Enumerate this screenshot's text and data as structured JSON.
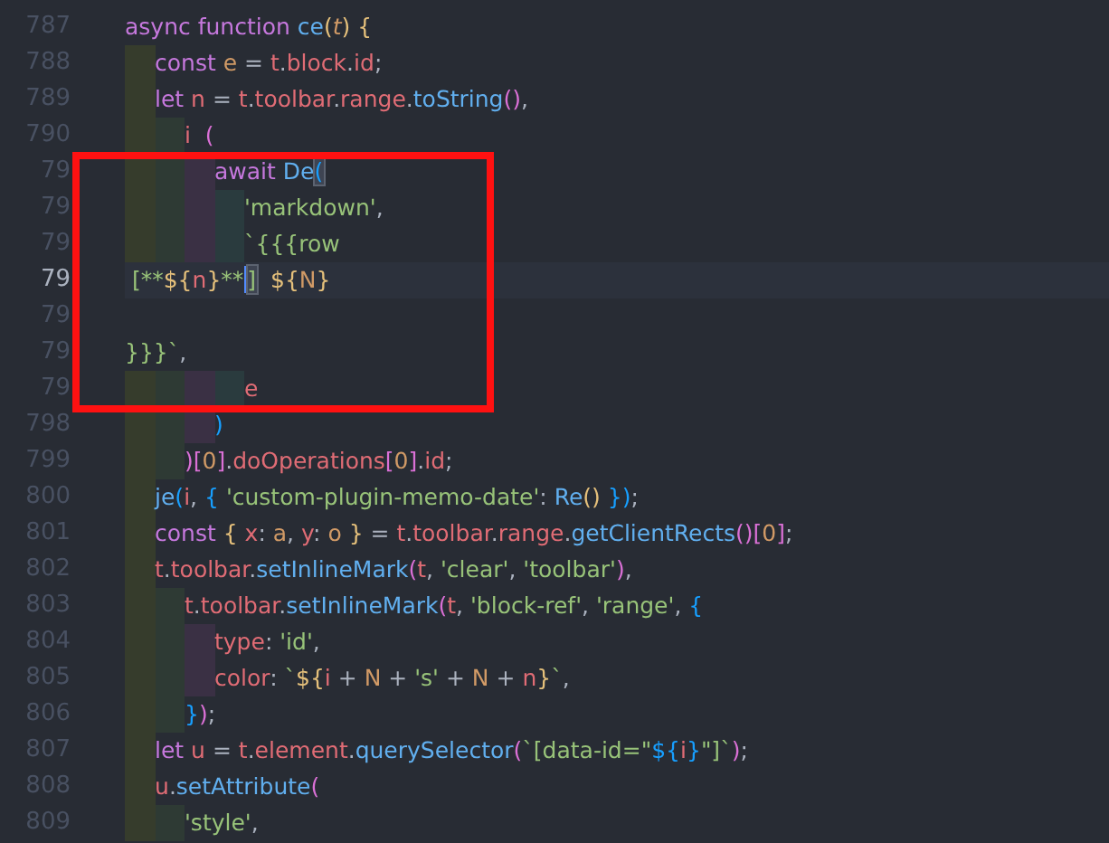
{
  "editor": {
    "lines": [
      {
        "number": "787",
        "current": false,
        "tokens": [
          {
            "text": "async ",
            "kind": "keyword"
          },
          {
            "text": "function ",
            "kind": "keyword"
          },
          {
            "text": "ce",
            "kind": "function"
          },
          {
            "text": "(",
            "kind": "bracket"
          },
          {
            "text": "t",
            "kind": "parameter"
          },
          {
            "text": ")",
            "kind": "bracket"
          },
          {
            "text": " {",
            "kind": "bracket"
          }
        ]
      },
      {
        "number": "788",
        "current": false,
        "tokens": [
          {
            "text": "    const ",
            "kind": "keyword"
          },
          {
            "text": "e",
            "kind": "number"
          },
          {
            "text": " = ",
            "kind": "operator"
          },
          {
            "text": "t",
            "kind": "variable"
          },
          {
            "text": ".",
            "kind": "operator"
          },
          {
            "text": "block",
            "kind": "variable"
          },
          {
            "text": ".",
            "kind": "operator"
          },
          {
            "text": "id",
            "kind": "variable"
          },
          {
            "text": ";",
            "kind": "operator"
          }
        ]
      },
      {
        "number": "789",
        "current": false,
        "tokens": [
          {
            "text": "    let ",
            "kind": "keyword"
          },
          {
            "text": "n",
            "kind": "variable"
          },
          {
            "text": " = ",
            "kind": "operator"
          },
          {
            "text": "t",
            "kind": "variable"
          },
          {
            "text": ".",
            "kind": "operator"
          },
          {
            "text": "toolbar",
            "kind": "variable"
          },
          {
            "text": ".",
            "kind": "operator"
          },
          {
            "text": "range",
            "kind": "variable"
          },
          {
            "text": ".",
            "kind": "operator"
          },
          {
            "text": "toString",
            "kind": "function"
          },
          {
            "text": "()",
            "kind": "paren"
          },
          {
            "text": ",",
            "kind": "operator"
          }
        ]
      },
      {
        "number": "790",
        "current": false,
        "tokens": [
          {
            "text": "        i",
            "kind": "variable"
          },
          {
            "text": "  (",
            "kind": "paren"
          }
        ]
      },
      {
        "number": "79",
        "current": false,
        "tokens": [
          {
            "text": "            await ",
            "kind": "keyword"
          },
          {
            "text": "De",
            "kind": "function"
          },
          {
            "text": "(",
            "kind": "brace",
            "matched": true,
            "cursor": false
          }
        ]
      },
      {
        "number": "79",
        "current": false,
        "tokens": [
          {
            "text": "                'markdown'",
            "kind": "string"
          },
          {
            "text": ",",
            "kind": "operator"
          }
        ]
      },
      {
        "number": "79",
        "current": false,
        "tokens": [
          {
            "text": "                `{{{row",
            "kind": "string"
          }
        ]
      },
      {
        "number": "79",
        "current": true,
        "tokens": [
          {
            "text": " [**",
            "kind": "string"
          },
          {
            "text": "${",
            "kind": "bracket"
          },
          {
            "text": "n",
            "kind": "variable"
          },
          {
            "text": "}",
            "kind": "bracket"
          },
          {
            "text": "**",
            "kind": "string",
            "matched": false,
            "cursor": true
          },
          {
            "text": "]",
            "kind": "string",
            "matched": true,
            "cursor": false
          },
          {
            "text": "  ${",
            "kind": "bracket"
          },
          {
            "text": "N",
            "kind": "number"
          },
          {
            "text": "}",
            "kind": "bracket"
          }
        ]
      },
      {
        "number": "79",
        "current": false
      },
      {
        "number": "79",
        "current": false,
        "tokens": [
          {
            "text": "}}}`",
            "kind": "string"
          },
          {
            "text": ",",
            "kind": "operator"
          }
        ]
      },
      {
        "number": "79",
        "current": false,
        "tokens": [
          {
            "text": "                e",
            "kind": "variable"
          }
        ]
      },
      {
        "number": "798",
        "current": false,
        "tokens": [
          {
            "text": "            )",
            "kind": "brace"
          }
        ]
      },
      {
        "number": "799",
        "current": false,
        "tokens": [
          {
            "text": "        )[",
            "kind": "paren"
          },
          {
            "text": "0",
            "kind": "number"
          },
          {
            "text": "]",
            "kind": "paren"
          },
          {
            "text": ".",
            "kind": "operator"
          },
          {
            "text": "doOperations",
            "kind": "variable"
          },
          {
            "text": "[",
            "kind": "paren"
          },
          {
            "text": "0",
            "kind": "number"
          },
          {
            "text": "]",
            "kind": "paren"
          },
          {
            "text": ".",
            "kind": "operator"
          },
          {
            "text": "id",
            "kind": "variable"
          },
          {
            "text": ";",
            "kind": "operator"
          }
        ]
      },
      {
        "number": "800",
        "current": false,
        "tokens": [
          {
            "text": "    je",
            "kind": "function"
          },
          {
            "text": "(",
            "kind": "brace"
          },
          {
            "text": "i",
            "kind": "variable"
          },
          {
            "text": ", ",
            "kind": "operator"
          },
          {
            "text": "{ ",
            "kind": "brace"
          },
          {
            "text": "'custom-plugin-memo-date'",
            "kind": "string"
          },
          {
            "text": ": ",
            "kind": "operator"
          },
          {
            "text": "Re",
            "kind": "function"
          },
          {
            "text": "()",
            "kind": "bracket"
          },
          {
            "text": " })",
            "kind": "brace"
          },
          {
            "text": ";",
            "kind": "operator"
          }
        ]
      },
      {
        "number": "801",
        "current": false,
        "tokens": [
          {
            "text": "    const ",
            "kind": "keyword"
          },
          {
            "text": "{ ",
            "kind": "bracket"
          },
          {
            "text": "x",
            "kind": "variable"
          },
          {
            "text": ": ",
            "kind": "operator"
          },
          {
            "text": "a",
            "kind": "number"
          },
          {
            "text": ", ",
            "kind": "operator"
          },
          {
            "text": "y",
            "kind": "variable"
          },
          {
            "text": ": ",
            "kind": "operator"
          },
          {
            "text": "o",
            "kind": "number"
          },
          {
            "text": " }",
            "kind": "bracket"
          },
          {
            "text": " = ",
            "kind": "operator"
          },
          {
            "text": "t",
            "kind": "variable"
          },
          {
            "text": ".",
            "kind": "operator"
          },
          {
            "text": "toolbar",
            "kind": "variable"
          },
          {
            "text": ".",
            "kind": "operator"
          },
          {
            "text": "range",
            "kind": "variable"
          },
          {
            "text": ".",
            "kind": "operator"
          },
          {
            "text": "getClientRects",
            "kind": "function"
          },
          {
            "text": "()[",
            "kind": "paren"
          },
          {
            "text": "0",
            "kind": "number"
          },
          {
            "text": "]",
            "kind": "paren"
          },
          {
            "text": ";",
            "kind": "operator"
          }
        ]
      },
      {
        "number": "802",
        "current": false,
        "tokens": [
          {
            "text": "    t",
            "kind": "variable"
          },
          {
            "text": ".",
            "kind": "operator"
          },
          {
            "text": "toolbar",
            "kind": "variable"
          },
          {
            "text": ".",
            "kind": "operator"
          },
          {
            "text": "setInlineMark",
            "kind": "function"
          },
          {
            "text": "(",
            "kind": "paren"
          },
          {
            "text": "t",
            "kind": "variable"
          },
          {
            "text": ", ",
            "kind": "operator"
          },
          {
            "text": "'clear'",
            "kind": "string"
          },
          {
            "text": ", ",
            "kind": "operator"
          },
          {
            "text": "'toolbar'",
            "kind": "string"
          },
          {
            "text": ")",
            "kind": "paren"
          },
          {
            "text": ",",
            "kind": "operator"
          }
        ]
      },
      {
        "number": "803",
        "current": false,
        "tokens": [
          {
            "text": "        t",
            "kind": "variable"
          },
          {
            "text": ".",
            "kind": "operator"
          },
          {
            "text": "toolbar",
            "kind": "variable"
          },
          {
            "text": ".",
            "kind": "operator"
          },
          {
            "text": "setInlineMark",
            "kind": "function"
          },
          {
            "text": "(",
            "kind": "paren"
          },
          {
            "text": "t",
            "kind": "variable"
          },
          {
            "text": ", ",
            "kind": "operator"
          },
          {
            "text": "'block-ref'",
            "kind": "string"
          },
          {
            "text": ", ",
            "kind": "operator"
          },
          {
            "text": "'range'",
            "kind": "string"
          },
          {
            "text": ", ",
            "kind": "operator"
          },
          {
            "text": "{",
            "kind": "brace"
          }
        ]
      },
      {
        "number": "804",
        "current": false,
        "tokens": [
          {
            "text": "            type",
            "kind": "variable"
          },
          {
            "text": ": ",
            "kind": "operator"
          },
          {
            "text": "'id'",
            "kind": "string"
          },
          {
            "text": ",",
            "kind": "operator"
          }
        ]
      },
      {
        "number": "805",
        "current": false,
        "tokens": [
          {
            "text": "            color",
            "kind": "variable"
          },
          {
            "text": ": ",
            "kind": "operator"
          },
          {
            "text": "`",
            "kind": "string"
          },
          {
            "text": "${",
            "kind": "bracket"
          },
          {
            "text": "i",
            "kind": "variable"
          },
          {
            "text": " + ",
            "kind": "operator"
          },
          {
            "text": "N",
            "kind": "number"
          },
          {
            "text": " + ",
            "kind": "operator"
          },
          {
            "text": "'s'",
            "kind": "string"
          },
          {
            "text": " + ",
            "kind": "operator"
          },
          {
            "text": "N",
            "kind": "number"
          },
          {
            "text": " + ",
            "kind": "operator"
          },
          {
            "text": "n",
            "kind": "variable"
          },
          {
            "text": "}",
            "kind": "bracket"
          },
          {
            "text": "`",
            "kind": "string"
          },
          {
            "text": ",",
            "kind": "operator"
          }
        ]
      },
      {
        "number": "806",
        "current": false,
        "tokens": [
          {
            "text": "        }",
            "kind": "brace"
          },
          {
            "text": ")",
            "kind": "paren"
          },
          {
            "text": ";",
            "kind": "operator"
          }
        ]
      },
      {
        "number": "807",
        "current": false,
        "tokens": [
          {
            "text": "    let ",
            "kind": "keyword"
          },
          {
            "text": "u",
            "kind": "variable"
          },
          {
            "text": " = ",
            "kind": "operator"
          },
          {
            "text": "t",
            "kind": "variable"
          },
          {
            "text": ".",
            "kind": "operator"
          },
          {
            "text": "element",
            "kind": "variable"
          },
          {
            "text": ".",
            "kind": "operator"
          },
          {
            "text": "querySelector",
            "kind": "function"
          },
          {
            "text": "(",
            "kind": "paren"
          },
          {
            "text": "`[data-id=\"",
            "kind": "string"
          },
          {
            "text": "${",
            "kind": "brace"
          },
          {
            "text": "i",
            "kind": "variable"
          },
          {
            "text": "}",
            "kind": "brace"
          },
          {
            "text": "\"]`",
            "kind": "string"
          },
          {
            "text": ")",
            "kind": "paren"
          },
          {
            "text": ";",
            "kind": "operator"
          }
        ]
      },
      {
        "number": "808",
        "current": false,
        "tokens": [
          {
            "text": "    u",
            "kind": "variable"
          },
          {
            "text": ".",
            "kind": "operator"
          },
          {
            "text": "setAttribute",
            "kind": "function"
          },
          {
            "text": "(",
            "kind": "paren"
          }
        ]
      },
      {
        "number": "809",
        "current": false,
        "tokens": [
          {
            "text": "        'style'",
            "kind": "string"
          },
          {
            "text": ",",
            "kind": "operator"
          }
        ]
      }
    ]
  }
}
